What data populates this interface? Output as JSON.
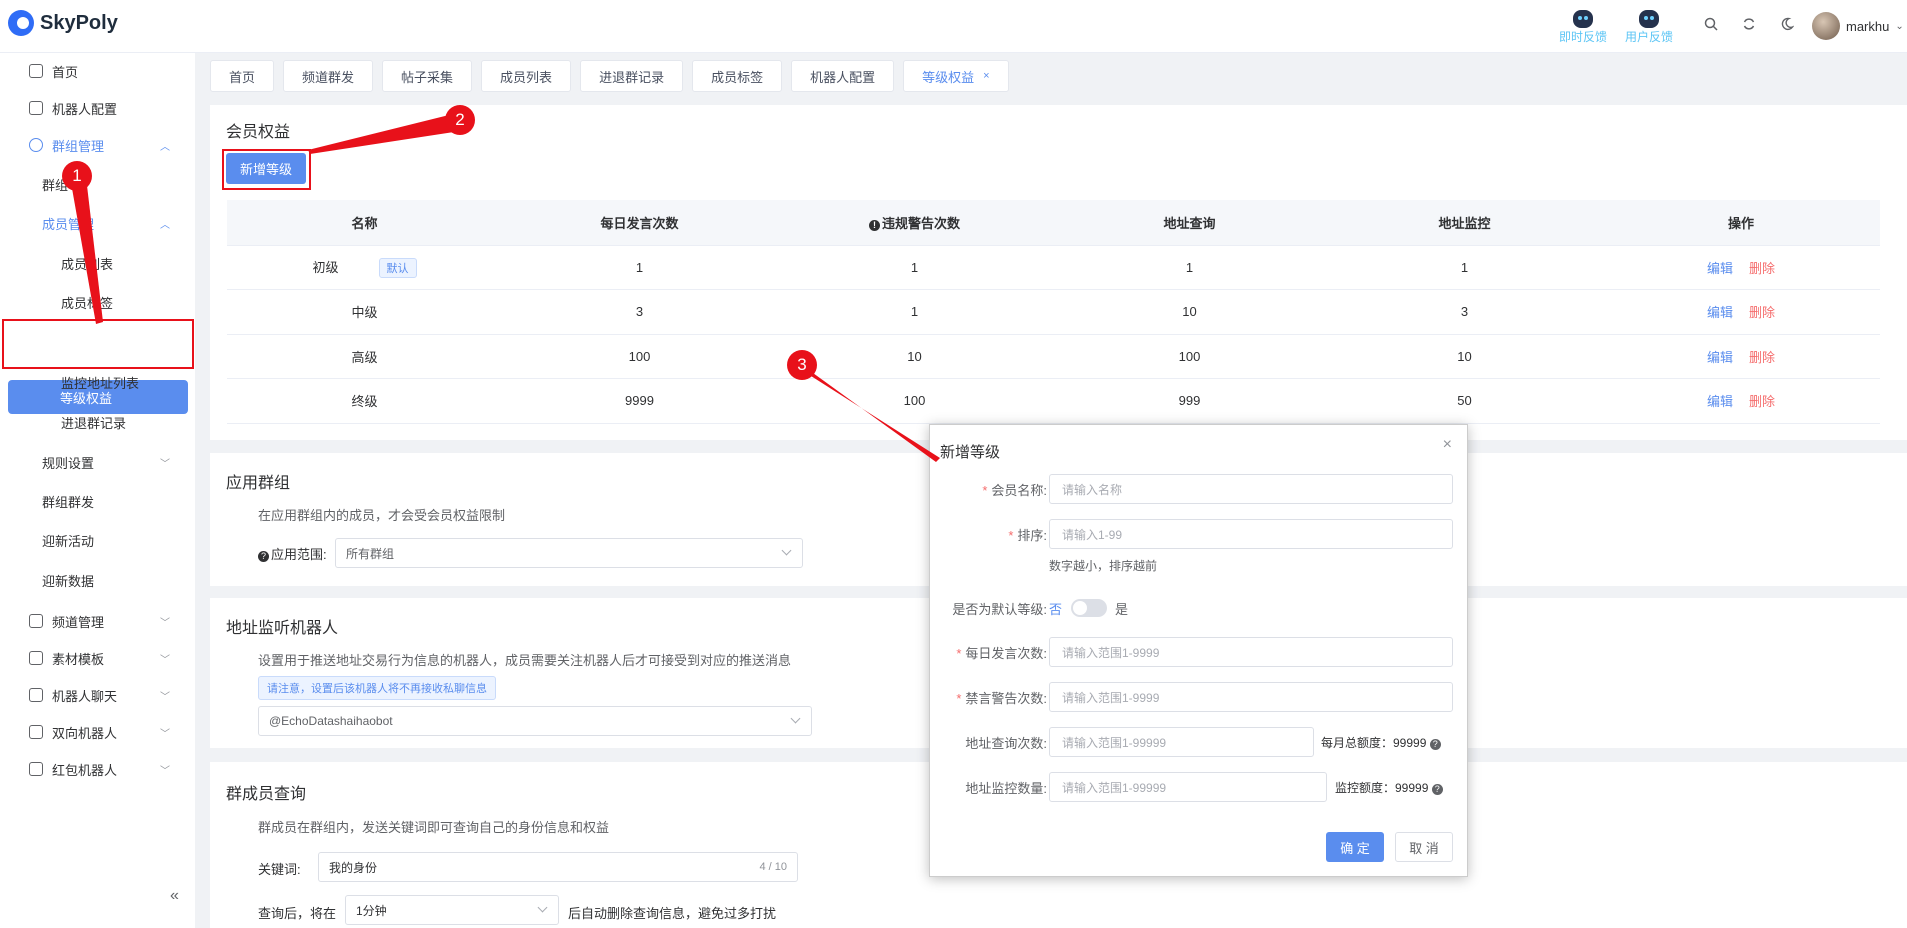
{
  "app": {
    "name": "SkyPoly"
  },
  "header": {
    "links": [
      {
        "label": "即时反馈",
        "icon": "robot-icon"
      },
      {
        "label": "用户反馈",
        "icon": "robot-icon"
      }
    ],
    "icons": [
      "search-icon",
      "refresh-icon",
      "moon-icon"
    ],
    "user": {
      "name": "markhu"
    }
  },
  "sidebar": {
    "items": [
      {
        "label": "首页"
      },
      {
        "label": "机器人配置"
      },
      {
        "label": "群组管理"
      },
      {
        "label": "群组"
      },
      {
        "label": "成员管理"
      },
      {
        "label": "成员列表"
      },
      {
        "label": "成员标签"
      },
      {
        "label": "等级权益"
      },
      {
        "label": "监控地址列表"
      },
      {
        "label": "进退群记录"
      },
      {
        "label": "规则设置"
      },
      {
        "label": "群组群发"
      },
      {
        "label": "迎新活动"
      },
      {
        "label": "迎新数据"
      },
      {
        "label": "频道管理"
      },
      {
        "label": "素材模板"
      },
      {
        "label": "机器人聊天"
      },
      {
        "label": "双向机器人"
      },
      {
        "label": "红包机器人"
      }
    ]
  },
  "tabs": [
    {
      "label": "首页"
    },
    {
      "label": "频道群发"
    },
    {
      "label": "帖子采集"
    },
    {
      "label": "成员列表"
    },
    {
      "label": "进退群记录"
    },
    {
      "label": "成员标签"
    },
    {
      "label": "机器人配置"
    },
    {
      "label": "等级权益",
      "active": true,
      "close": "×"
    }
  ],
  "benefits": {
    "title": "会员权益",
    "add_button": "新增等级",
    "columns": [
      "名称",
      "每日发言次数",
      "违规警告次数",
      "地址查询",
      "地址监控",
      "操作"
    ],
    "default_tag": "默认",
    "edit_label": "编辑",
    "delete_label": "删除",
    "rows": [
      {
        "name": "初级",
        "daily": "1",
        "warn": "1",
        "query": "1",
        "monitor": "1"
      },
      {
        "name": "中级",
        "daily": "3",
        "warn": "1",
        "query": "10",
        "monitor": "3"
      },
      {
        "name": "高级",
        "daily": "100",
        "warn": "10",
        "query": "100",
        "monitor": "10"
      },
      {
        "name": "终级",
        "daily": "9999",
        "warn": "100",
        "query": "999",
        "monitor": "50"
      }
    ]
  },
  "apply_group": {
    "title": "应用群组",
    "desc": "在应用群组内的成员，才会受会员权益限制",
    "scope_label": "应用范围:",
    "scope_value": "所有群组"
  },
  "address_bot": {
    "title": "地址监听机器人",
    "desc": "设置用于推送地址交易行为信息的机器人，成员需要关注机器人后才可接受到对应的推送消息",
    "notice": "请注意，设置后该机器人将不再接收私聊信息",
    "bot_value": "@EchoDatashaihaobot"
  },
  "member_query": {
    "title": "群成员查询",
    "desc": "群成员在群组内，发送关键词即可查询自己的身份信息和权益",
    "keyword_label": "关键词:",
    "keyword_value": "我的身份",
    "keyword_count": "4 / 10",
    "after_label": "查询后，将在",
    "after_value": "1分钟",
    "after_suffix": "后自动删除查询信息，避免过多打扰"
  },
  "modal": {
    "title": "新增等级",
    "close": "×",
    "fields": {
      "name_label": "会员名称:",
      "name_placeholder": "请输入名称",
      "sort_label": "排序:",
      "sort_placeholder": "请输入1-99",
      "sort_hint": "数字越小，排序越前",
      "default_label": "是否为默认等级:",
      "default_off": "否",
      "default_on": "是",
      "daily_label": "每日发言次数:",
      "daily_placeholder": "请输入范围1-9999",
      "ban_label": "禁言警告次数:",
      "ban_placeholder": "请输入范围1-9999",
      "query_label": "地址查询次数:",
      "query_placeholder": "请输入范围1-99999",
      "query_quota": "每月总额度：99999",
      "monitor_label": "地址监控数量:",
      "monitor_placeholder": "请输入范围1-99999",
      "monitor_quota": "监控额度：99999"
    },
    "confirm": "确 定",
    "cancel": "取 消"
  },
  "annotations": {
    "badges": [
      "1",
      "2",
      "3"
    ],
    "color": "#e8111a"
  },
  "colors": {
    "primary": "#5a8dee",
    "danger": "#f56c6c"
  }
}
